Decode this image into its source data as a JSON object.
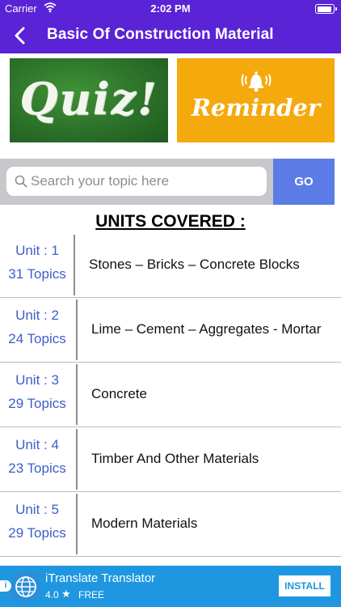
{
  "status_bar": {
    "carrier": "Carrier",
    "time": "2:02 PM",
    "battery_level": 0.95
  },
  "nav": {
    "title": "Basic Of Construction Material",
    "back_icon": "chevron-left-icon"
  },
  "banners": {
    "quiz_label": "Quiz!",
    "reminder_label": "Reminder",
    "reminder_icon": "bell-icon"
  },
  "search": {
    "placeholder": "Search your topic here",
    "value": "",
    "go_label": "GO"
  },
  "units_heading": "UNITS COVERED :",
  "units": [
    {
      "unit": "Unit : 1",
      "topics": "31 Topics",
      "title": "Stones – Bricks – Concrete Blocks"
    },
    {
      "unit": "Unit : 2",
      "topics": "24 Topics",
      "title": "Lime – Cement – Aggregates - Mortar"
    },
    {
      "unit": "Unit : 3",
      "topics": "29 Topics",
      "title": "Concrete"
    },
    {
      "unit": "Unit : 4",
      "topics": "23 Topics",
      "title": "Timber And Other Materials"
    },
    {
      "unit": "Unit : 5",
      "topics": "29 Topics",
      "title": "Modern Materials"
    }
  ],
  "ad": {
    "title": "iTranslate Translator",
    "rating": "4.0",
    "price": "FREE",
    "install_label": "INSTALL",
    "app_icon": "globe-icon"
  },
  "colors": {
    "header": "#5a23d6",
    "go_button": "#5b7be6",
    "unit_link": "#3d5ec9",
    "ad_bar": "#1e97e0"
  }
}
